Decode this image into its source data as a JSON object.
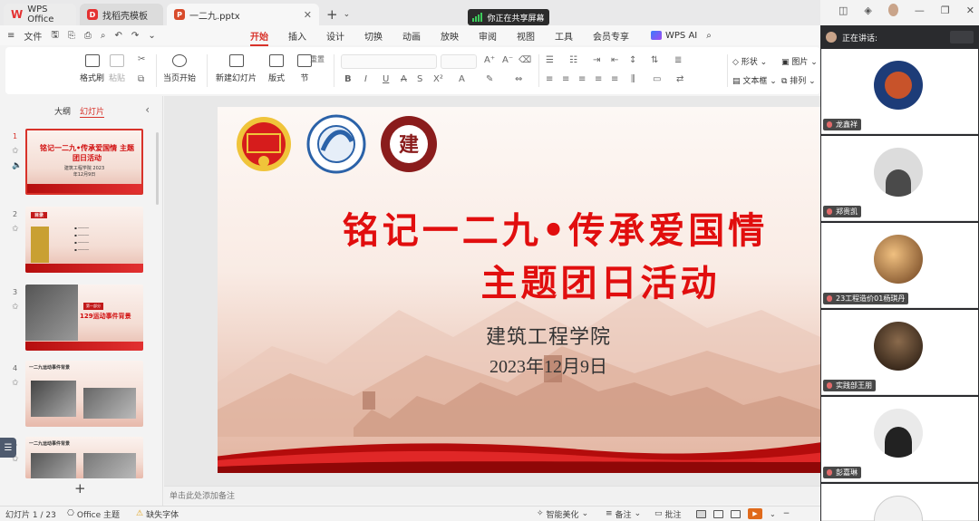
{
  "tabs": [
    {
      "label": "WPS Office",
      "icon": "wps-logo-icon"
    },
    {
      "label": "找稻壳模板",
      "icon": "docer-icon"
    },
    {
      "label": "一二九.pptx",
      "icon": "ppt-file-icon"
    }
  ],
  "share_banner": "你正在共享屏幕",
  "menu": {
    "file_label": "文件",
    "tabs": [
      "开始",
      "插入",
      "设计",
      "切换",
      "动画",
      "放映",
      "审阅",
      "视图",
      "工具",
      "会员专享"
    ],
    "active_tab": "开始",
    "wps_ai": "WPS AI"
  },
  "ribbon": {
    "format_painter": "格式刷",
    "paste": "粘贴",
    "from_current": "当页开始",
    "new_slide": "新建幻灯片",
    "layout": "版式",
    "section": "节",
    "reset": "重置",
    "shape": "形状",
    "picture": "图片",
    "textbox": "文本框",
    "arrange": "排列"
  },
  "left_panel": {
    "tab_outline": "大纲",
    "tab_slides": "幻灯片",
    "slides": [
      {
        "num": "1",
        "title": "铭记一二九•传承爱国情 主题团日活动",
        "sub": "建筑工程学院 2023年12月9日"
      },
      {
        "num": "2",
        "badge": "目录"
      },
      {
        "num": "3",
        "pill": "第一部分",
        "red": "129运动事件背景"
      },
      {
        "num": "4",
        "head": "一二九运动事件背景"
      },
      {
        "num": "5",
        "head": "一二九运动事件背景"
      }
    ]
  },
  "slide": {
    "title_line1": "铭记一二九•传承爱国情",
    "title_line2": "主题团日活动",
    "org": "建筑工程学院",
    "date": "2023年12月9日"
  },
  "notes_placeholder": "单击此处添加备注",
  "status": {
    "slide_counter": "幻灯片 1 / 23",
    "theme": "Office 主题",
    "missing_font": "缺失字体",
    "smart_beautify": "智能美化",
    "notes": "备注",
    "comments": "批注"
  },
  "meeting": {
    "speaking_label": "正在讲话:",
    "participants": [
      {
        "name": "龙鑫祥"
      },
      {
        "name": "郑贵凯"
      },
      {
        "name": "23工程造价01杨琪丹"
      },
      {
        "name": "实践部王朋"
      },
      {
        "name": "彭嘉琳"
      }
    ]
  },
  "colors": {
    "accent_red": "#d8322a",
    "slide_title_red": "#e10e0e",
    "meeting_bg": "#2a2b2e"
  }
}
